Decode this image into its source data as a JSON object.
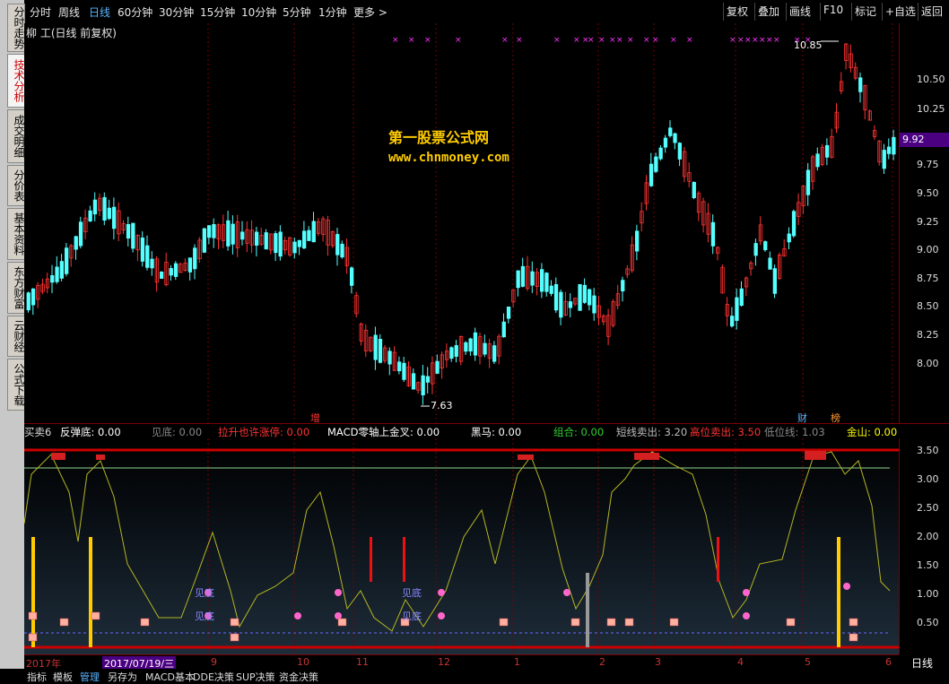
{
  "toolbar": {
    "periods": [
      "分时",
      "周线",
      "日线",
      "60分钟",
      "30分钟",
      "15分钟",
      "10分钟",
      "5分钟",
      "1分钟",
      "更多 >"
    ],
    "active_period": "日线",
    "right_buttons": [
      "复权",
      "叠加",
      "画线",
      "F10",
      "标记",
      "+自选",
      "返回"
    ]
  },
  "left_tabs": [
    "分时走势",
    "技术分析",
    "成交明细",
    "分价表",
    "基本资料",
    "东方财富",
    "云财经",
    "公式下载"
  ],
  "active_tab": "技术分析",
  "main_chart": {
    "title": "柳 工(日线 前复权)",
    "watermark_line1": "第一股票公式网",
    "watermark_line2": "www.chnmoney.com",
    "high_label": "10.85",
    "low_label": "7.63",
    "price_tag": "9.92",
    "y_ticks": [
      "10.50",
      "10.25",
      "10.00",
      "9.75",
      "9.50",
      "9.25",
      "9.00",
      "8.75",
      "8.50",
      "8.25",
      "8.00"
    ],
    "markers": {
      "zeng": "增",
      "cai": "财",
      "bang": "榜"
    }
  },
  "indicator_bar": {
    "items": [
      {
        "text": "买卖6",
        "color": "#ffffff"
      },
      {
        "text": "反弹底: 0.00",
        "color": "#ffffff"
      },
      {
        "text": "见底: 0.00",
        "color": "#888888"
      },
      {
        "text": "拉升也许涨停: 0.00",
        "color": "#ff3333"
      },
      {
        "text": "MACD零轴上金叉: 0.00",
        "color": "#ffffff"
      },
      {
        "text": "黑马: 0.00",
        "color": "#ffffff"
      },
      {
        "text": "组合: 0.00",
        "color": "#33cc33"
      },
      {
        "text": "短线卖出: 3.20",
        "color": "#bbbbbb"
      },
      {
        "text": "高位卖出: 3.50",
        "color": "#ff3333"
      },
      {
        "text": "低位线: 1.03",
        "color": "#888888"
      },
      {
        "text": "金山: 0.00",
        "color": "#ffff00"
      }
    ],
    "y_ticks": [
      "3.50",
      "3.00",
      "2.50",
      "2.00",
      "1.50",
      "1.00",
      "0.50"
    ],
    "signal_label": "见底"
  },
  "date_axis": {
    "labels": [
      "2017年",
      "2017/07/19/三",
      "9",
      "10",
      "11",
      "12",
      "1",
      "2",
      "3",
      "4",
      "5",
      "6"
    ],
    "period_label": "日线"
  },
  "bottom_bar": [
    "指标",
    "模板",
    "管理",
    "另存为",
    "MACD基本",
    "DDE决策",
    "SUP决策",
    "资金决策"
  ],
  "active_bottom": "管理",
  "colors": {
    "up": "#ff3232",
    "down": "#54ffff",
    "axis": "#7a0000",
    "grid": "#7a0000",
    "yellow_line": "#b5b522",
    "green_line": "#8fd48f"
  }
}
